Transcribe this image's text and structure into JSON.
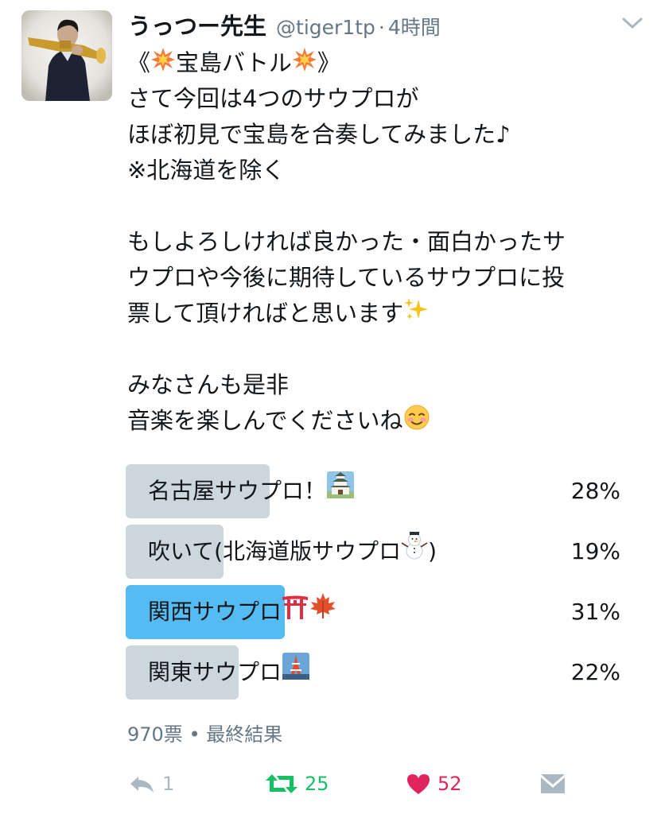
{
  "tweet": {
    "display_name": "うっつー先生",
    "handle": "@tiger1tp",
    "separator": "·",
    "time": "4時間",
    "avatar_icon": "avatar-photo-trumpet-player",
    "caret_icon": "chevron-down-icon",
    "lines": {
      "l1_open": "《",
      "l1_mid": "宝島バトル",
      "l1_close": "》",
      "l2": "さて今回は4つのサウプロが",
      "l3": "ほぼ初見で宝島を合奏してみました♪",
      "l4": "※北海道を除く",
      "l5": "もしよろしければ良かった・面白かったサ",
      "l6": "ウプロや今後に期待しているサウプロに投",
      "l7": "票して頂ければと思います",
      "l8": "みなさんも是非",
      "l9": "音楽を楽しんでくださいね"
    }
  },
  "poll": {
    "options": [
      {
        "label": "名古屋サウプロ！",
        "percent": "28%",
        "share": 0.28,
        "emoji": "castle-emoji"
      },
      {
        "label": "吹いて(北海道版サウプロ",
        "label_end": ")",
        "percent": "19%",
        "share": 0.19,
        "emoji": "snowman-emoji"
      },
      {
        "label": "関西サウプロ",
        "percent": "31%",
        "share": 0.31,
        "emoji": "torii-emoji maple-leaf-emoji",
        "winner": true
      },
      {
        "label": "関東サウプロ",
        "percent": "22%",
        "share": 0.22,
        "emoji": "tokyo-tower-emoji"
      }
    ],
    "votes": "970票",
    "bullet": "•",
    "status": "最終結果"
  },
  "actions": {
    "reply_count": "1",
    "retweet_count": "25",
    "like_count": "52"
  },
  "colors": {
    "bar": "#ccd6dd",
    "winner_bar": "#55bbf3",
    "secondary_text": "#657786",
    "retweet": "#17bf63",
    "like": "#e0245e"
  }
}
